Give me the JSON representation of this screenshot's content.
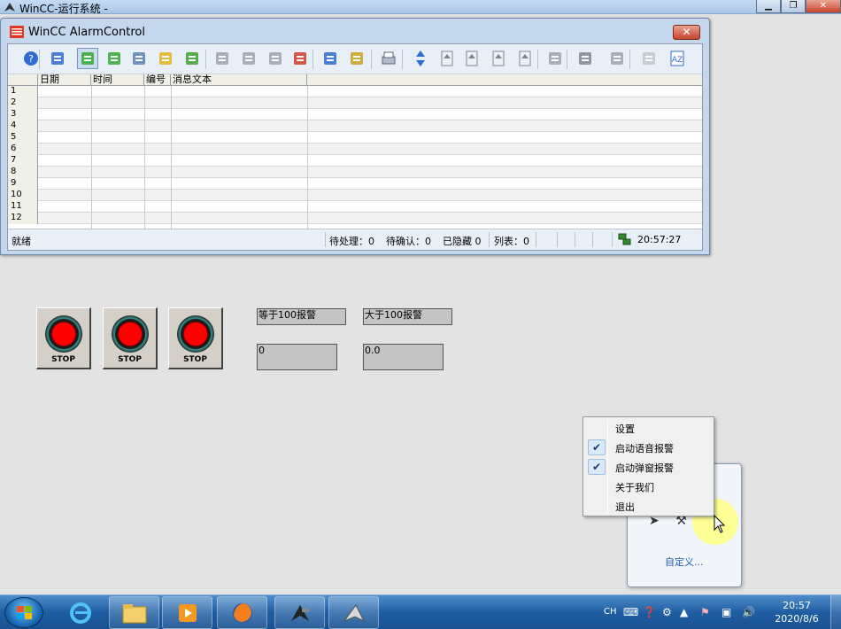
{
  "main_window": {
    "title": "WinCC-运行系统 -"
  },
  "alarm_window": {
    "title": "WinCC AlarmControl",
    "close_label": "✕",
    "columns": [
      "日期",
      "时间",
      "编号",
      "消息文本"
    ],
    "rows": [
      "1",
      "2",
      "3",
      "4",
      "5",
      "6",
      "7",
      "8",
      "9",
      "10",
      "11",
      "12"
    ],
    "status": {
      "ready": "就绪",
      "pending": "待处理：0",
      "unacked": "待确认：0",
      "hidden": "已隐藏 0",
      "list": "列表：0",
      "time": "20:57:27"
    },
    "toolbar_icons": [
      "help-icon",
      "configure-icon",
      "message-list-icon",
      "history-list-icon",
      "journal-list-icon",
      "lock-list-icon",
      "statistics-list-icon",
      "ack-central-icon",
      "single-ack-icon",
      "group-ack-icon",
      "emergency-ack-icon",
      "selection-dialog-icon",
      "display-options-icon",
      "print-icon",
      "autoscroll-icon",
      "first-message-icon",
      "previous-message-icon",
      "next-message-icon",
      "last-message-icon",
      "info-text-icon",
      "comment-icon",
      "loop-in-alarm-icon",
      "lock-icon",
      "sort-dialog-icon",
      "time-base-icon"
    ]
  },
  "stop_buttons": [
    {
      "label": "STOP"
    },
    {
      "label": "STOP"
    },
    {
      "label": "STOP"
    }
  ],
  "io_fields": {
    "equal_label": "等于100报警",
    "greater_label": "大于100报警",
    "equal_value": "0",
    "greater_value": "0.0"
  },
  "context_menu": {
    "items": [
      {
        "label": "设置",
        "checked": false
      },
      {
        "label": "启动语音报警",
        "checked": true
      },
      {
        "label": "启动弹窗报警",
        "checked": true
      },
      {
        "label": "关于我们",
        "checked": false
      },
      {
        "label": "退出",
        "checked": false
      }
    ],
    "check_glyph": "✔"
  },
  "tray_popup": {
    "customize": "自定义..."
  },
  "taskbar": {
    "language": "CH",
    "time": "20:57",
    "date": "2020/8/6",
    "tasks": [
      "ie-icon",
      "explorer-icon",
      "media-player-icon",
      "firefox-icon",
      "wincc-tool-icon",
      "wincc-runtime-icon"
    ]
  },
  "colors": {
    "accent": "#1f5ea3",
    "stop_red": "#ff0000",
    "io_gray": "#c4c4c4"
  }
}
